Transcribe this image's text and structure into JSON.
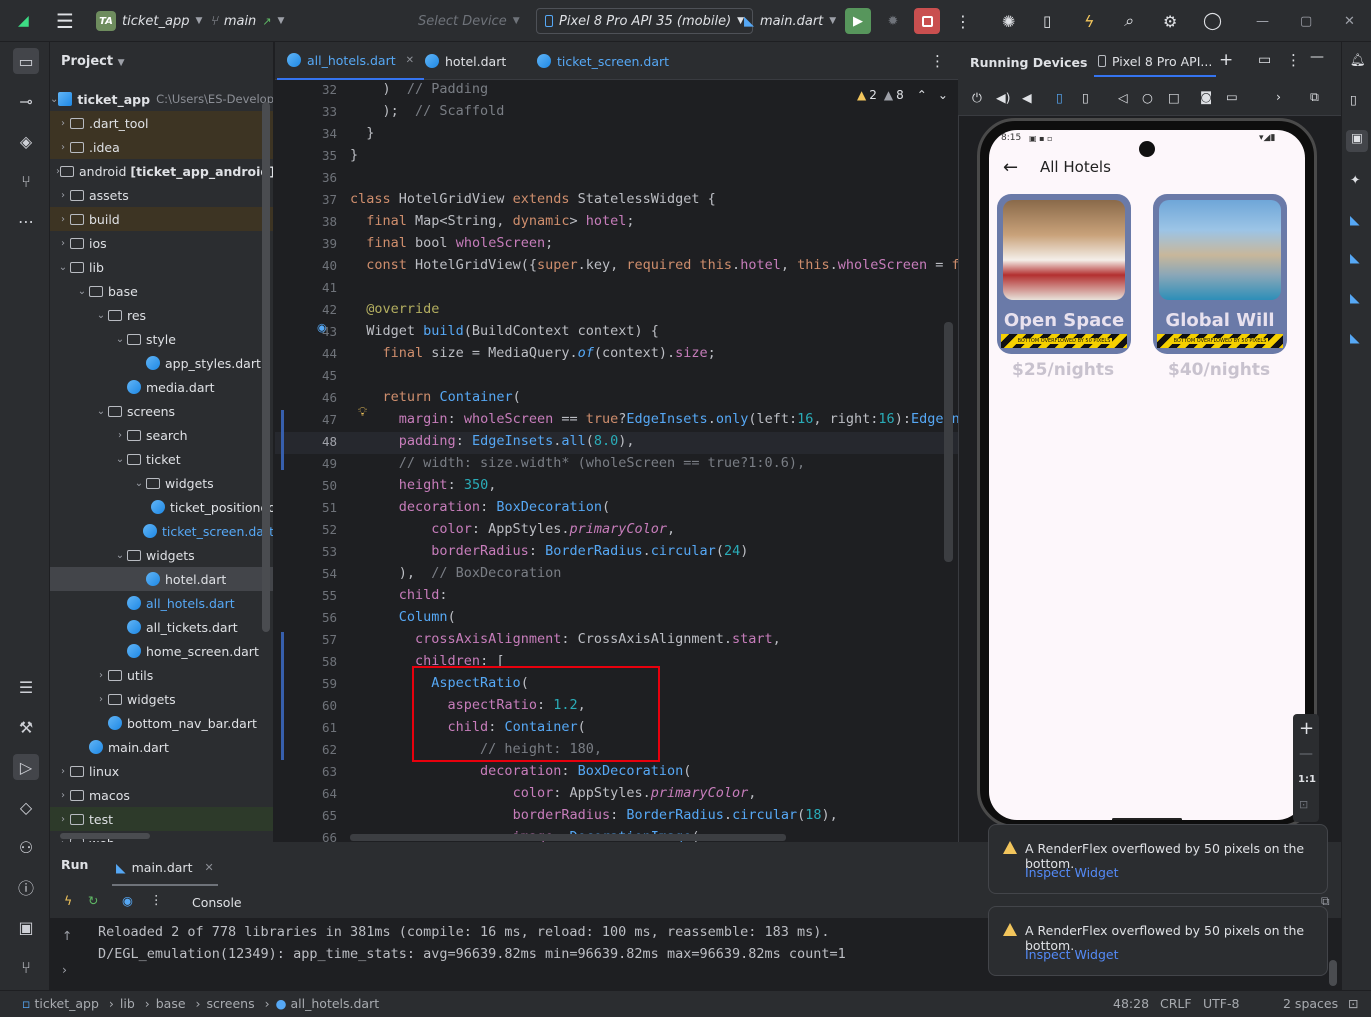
{
  "titlebar": {
    "project_badge": "TA",
    "project_name": "ticket_app",
    "branch": "main",
    "select_device": "Select Device",
    "device": "Pixel 8 Pro API 35 (mobile)",
    "run_config": "main.dart"
  },
  "project_panel": {
    "title": "Project",
    "root": "ticket_app",
    "root_path": "C:\\Users\\ES-Developer",
    "items": [
      {
        "label": ".dart_tool",
        "depth": 0,
        "type": "folder",
        "expanded": false
      },
      {
        "label": ".idea",
        "depth": 0,
        "type": "folder",
        "expanded": false
      },
      {
        "label": "android [ticket_app_android]",
        "depth": 0,
        "type": "folder",
        "expanded": false
      },
      {
        "label": "assets",
        "depth": 0,
        "type": "folder",
        "expanded": false
      },
      {
        "label": "build",
        "depth": 0,
        "type": "folder",
        "expanded": false
      },
      {
        "label": "ios",
        "depth": 0,
        "type": "folder",
        "expanded": false
      },
      {
        "label": "lib",
        "depth": 0,
        "type": "folder",
        "expanded": true
      },
      {
        "label": "base",
        "depth": 1,
        "type": "folder",
        "expanded": true
      },
      {
        "label": "res",
        "depth": 2,
        "type": "folder",
        "expanded": true
      },
      {
        "label": "style",
        "depth": 3,
        "type": "folder",
        "expanded": true
      },
      {
        "label": "app_styles.dart",
        "depth": 4,
        "type": "dart"
      },
      {
        "label": "media.dart",
        "depth": 3,
        "type": "dart"
      },
      {
        "label": "screens",
        "depth": 2,
        "type": "folder",
        "expanded": true
      },
      {
        "label": "search",
        "depth": 3,
        "type": "folder",
        "expanded": false
      },
      {
        "label": "ticket",
        "depth": 3,
        "type": "folder",
        "expanded": true
      },
      {
        "label": "widgets",
        "depth": 4,
        "type": "folder",
        "expanded": true
      },
      {
        "label": "ticket_positioned",
        "depth": 5,
        "type": "dart"
      },
      {
        "label": "ticket_screen.dart",
        "depth": 4,
        "type": "dart"
      },
      {
        "label": "widgets",
        "depth": 3,
        "type": "folder",
        "expanded": true
      },
      {
        "label": "hotel.dart",
        "depth": 4,
        "type": "dart"
      },
      {
        "label": "all_hotels.dart",
        "depth": 3,
        "type": "dart"
      },
      {
        "label": "all_tickets.dart",
        "depth": 3,
        "type": "dart"
      },
      {
        "label": "home_screen.dart",
        "depth": 3,
        "type": "dart"
      },
      {
        "label": "utils",
        "depth": 2,
        "type": "folder",
        "expanded": false
      },
      {
        "label": "widgets",
        "depth": 2,
        "type": "folder",
        "expanded": false
      },
      {
        "label": "bottom_nav_bar.dart",
        "depth": 2,
        "type": "dart"
      },
      {
        "label": "main.dart",
        "depth": 1,
        "type": "dart"
      },
      {
        "label": "linux",
        "depth": 0,
        "type": "folder",
        "expanded": false
      },
      {
        "label": "macos",
        "depth": 0,
        "type": "folder",
        "expanded": false
      },
      {
        "label": "test",
        "depth": 0,
        "type": "folder",
        "expanded": false
      },
      {
        "label": "web",
        "depth": 0,
        "type": "folder",
        "expanded": false
      }
    ]
  },
  "editor": {
    "tabs": [
      {
        "label": "all_hotels.dart",
        "active": true,
        "closable": true
      },
      {
        "label": "hotel.dart",
        "active": false,
        "closable": false
      },
      {
        "label": "ticket_screen.dart",
        "active": false,
        "closable": false
      }
    ],
    "warnings": "2",
    "weak_warnings": "8",
    "current_line": "48",
    "lines": [
      {
        "n": "32",
        "html": "    )  <span class=\"cm\">// Padding</span>"
      },
      {
        "n": "33",
        "html": "    );  <span class=\"cm\">// Scaffold</span>"
      },
      {
        "n": "34",
        "html": "  }"
      },
      {
        "n": "35",
        "html": "}"
      },
      {
        "n": "36",
        "html": ""
      },
      {
        "n": "37",
        "html": "<span class=\"kw\">class</span> HotelGridView <span class=\"kw\">extends</span> StatelessWidget {"
      },
      {
        "n": "38",
        "html": "  <span class=\"kw\">final</span> Map&lt;String, <span class=\"kw\">dynamic</span>&gt; <span class=\"pr\">hotel</span>;"
      },
      {
        "n": "39",
        "html": "  <span class=\"kw\">final</span> bool <span class=\"pr\">wholeScreen</span>;"
      },
      {
        "n": "40",
        "html": "  <span class=\"kw\">const</span> HotelGridView({<span class=\"kw\">super</span>.key, <span class=\"kw\">required this</span>.<span class=\"pr\">hotel</span>, <span class=\"kw\">this</span>.<span class=\"pr\">wholeScreen</span> = <span class=\"kw\">fa</span>"
      },
      {
        "n": "41",
        "html": ""
      },
      {
        "n": "42",
        "html": "  <span class=\"an\">@override</span>"
      },
      {
        "n": "43",
        "html": "  Widget <span class=\"fn\">build</span>(BuildContext context) {"
      },
      {
        "n": "44",
        "html": "    <span class=\"kw\">final</span> size = MediaQuery.<span class=\"fn it\">of</span>(context).<span class=\"pr\">size</span>;"
      },
      {
        "n": "45",
        "html": ""
      },
      {
        "n": "46",
        "html": "    <span class=\"kw\">return</span> <span class=\"fn\">Container</span>("
      },
      {
        "n": "47",
        "html": "      <span class=\"pr\">margin</span>: <span class=\"pr\">wholeScreen</span> == <span class=\"kw\">true</span>?<span class=\"fn\">EdgeInsets</span>.<span class=\"fn\">only</span>(left:<span class=\"nm\">16</span>, right:<span class=\"nm\">16</span>):<span class=\"fn\">EdgeIns</span>"
      },
      {
        "n": "48",
        "html": "      <span class=\"pr\">padding</span>: <span class=\"fn\">EdgeInsets</span>.<span class=\"fn\">all</span>(<span class=\"nm\">8.0</span>),"
      },
      {
        "n": "49",
        "html": "      <span class=\"cm\">// width: size.width* (wholeScreen == true?1:0.6),</span>"
      },
      {
        "n": "50",
        "html": "      <span class=\"pr\">height</span>: <span class=\"nm\">350</span>,"
      },
      {
        "n": "51",
        "html": "      <span class=\"pr\">decoration</span>: <span class=\"fn\">BoxDecoration</span>("
      },
      {
        "n": "52",
        "html": "          <span class=\"pr\">color</span>: AppStyles.<span class=\"pr it\">primaryColor</span>,"
      },
      {
        "n": "53",
        "html": "          <span class=\"pr\">borderRadius</span>: <span class=\"fn\">BorderRadius</span>.<span class=\"fn\">circular</span>(<span class=\"nm\">24</span>)"
      },
      {
        "n": "54",
        "html": "      ),  <span class=\"cm\">// BoxDecoration</span>"
      },
      {
        "n": "55",
        "html": "      <span class=\"pr\">child</span>:"
      },
      {
        "n": "56",
        "html": "      <span class=\"fn\">Column</span>("
      },
      {
        "n": "57",
        "html": "        <span class=\"pr\">crossAxisAlignment</span>: CrossAxisAlignment.<span class=\"pr\">start</span>,"
      },
      {
        "n": "58",
        "html": "        <span class=\"pr\">children</span>: ["
      },
      {
        "n": "59",
        "html": "          <span class=\"fn\">AspectRatio</span>("
      },
      {
        "n": "60",
        "html": "            <span class=\"pr\">aspectRatio</span>: <span class=\"nm\">1.2</span>,"
      },
      {
        "n": "61",
        "html": "            <span class=\"pr\">child</span>: <span class=\"fn\">Container</span>("
      },
      {
        "n": "62",
        "html": "                <span class=\"cm\">// height: 180,</span>"
      },
      {
        "n": "63",
        "html": "                <span class=\"pr\">decoration</span>: <span class=\"fn\">BoxDecoration</span>("
      },
      {
        "n": "64",
        "html": "                    <span class=\"pr\">color</span>: AppStyles.<span class=\"pr it\">primaryColor</span>,"
      },
      {
        "n": "65",
        "html": "                    <span class=\"pr\">borderRadius</span>: <span class=\"fn\">BorderRadius</span>.<span class=\"fn\">circular</span>(<span class=\"nm\">18</span>),"
      },
      {
        "n": "66",
        "html": "                    <span class=\"pr\">image</span>: <span class=\"fn\">DecorationImage</span>("
      }
    ]
  },
  "devices": {
    "title": "Running Devices",
    "tab": "Pixel 8 Pro API...",
    "phone": {
      "time": "8:15",
      "app_title": "All Hotels",
      "hotels": [
        {
          "name": "Open Space",
          "price": "$25/nights",
          "overflow": "BOTTOM OVERFLOWED BY 50 PIXELS"
        },
        {
          "name": "Global Will",
          "price": "$40/nights",
          "overflow": "BOTTOM OVERFLOWED BY 50 PIXELS"
        }
      ]
    },
    "zoom_label": "1:1"
  },
  "run": {
    "tab_label": "Run",
    "config": "main.dart",
    "console_label": "Console",
    "console_lines": [
      "Reloaded 2 of 778 libraries in 381ms (compile: 16 ms, reload: 100 ms, reassemble: 183 ms).",
      "D/EGL_emulation(12349): app_time_stats: avg=96639.82ms min=96639.82ms max=96639.82ms count=1"
    ]
  },
  "notifications": [
    {
      "message": "A RenderFlex overflowed by 50 pixels on the bottom.",
      "action": "Inspect Widget"
    },
    {
      "message": "A RenderFlex overflowed by 50 pixels on the bottom.",
      "action": "Inspect Widget"
    }
  ],
  "statusbar": {
    "breadcrumbs": [
      "ticket_app",
      "lib",
      "base",
      "screens",
      "all_hotels.dart"
    ],
    "position": "48:28",
    "line_sep": "CRLF",
    "encoding": "UTF-8",
    "indent": "2 spaces"
  },
  "colors": {
    "accent": "#3574f0",
    "card": "#6a7aa8",
    "highlight_box": "#e8000d",
    "warning": "#f2c55c"
  }
}
